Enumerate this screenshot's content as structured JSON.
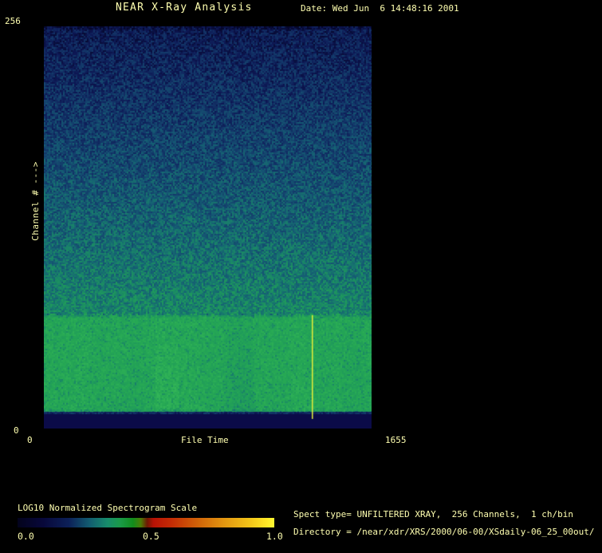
{
  "window": {
    "bg_color": "#000000",
    "text_color": "#ffffb0"
  },
  "header": {
    "title": "NEAR X-Ray Analysis",
    "date_label": "Date: Wed Jun  6 14:48:16 2001"
  },
  "plot": {
    "y_axis": {
      "label": "Channel # --->",
      "top_tick": "256",
      "bottom_tick": "0"
    },
    "x_axis": {
      "label": "File Time",
      "left_tick": "0",
      "right_tick": "1655"
    }
  },
  "colorbar": {
    "title": "LOG10 Normalized Spectrogram Scale",
    "ticks": [
      "0.0",
      "0.5",
      "1.0"
    ],
    "gradient": [
      {
        "pos": 0.0,
        "color": "#03031c"
      },
      {
        "pos": 0.1,
        "color": "#08083a"
      },
      {
        "pos": 0.2,
        "color": "#0c2058"
      },
      {
        "pos": 0.28,
        "color": "#125c70"
      },
      {
        "pos": 0.35,
        "color": "#178c6c"
      },
      {
        "pos": 0.4,
        "color": "#1a9a48"
      },
      {
        "pos": 0.45,
        "color": "#128c1c"
      },
      {
        "pos": 0.48,
        "color": "#4a7c06"
      },
      {
        "pos": 0.505,
        "color": "#6e1803"
      },
      {
        "pos": 0.53,
        "color": "#b81205"
      },
      {
        "pos": 0.6,
        "color": "#c42c05"
      },
      {
        "pos": 0.7,
        "color": "#d06208"
      },
      {
        "pos": 0.8,
        "color": "#e29410"
      },
      {
        "pos": 0.9,
        "color": "#f2c218"
      },
      {
        "pos": 0.97,
        "color": "#ffe826"
      },
      {
        "pos": 1.0,
        "color": "#fff832"
      }
    ]
  },
  "info": {
    "spect_type_line": "Spect type= UNFILTERED XRAY,  256 Channels,  1 ch/bin",
    "directory_line": "Directory = /near/xdr/XRS/2000/06-00/XSdaily-06_25_00out/"
  },
  "chart_data": {
    "type": "heatmap",
    "title": "NEAR X-Ray Analysis",
    "xlabel": "File Time",
    "ylabel": "Channel #",
    "xlim": [
      0,
      1655
    ],
    "ylim": [
      0,
      256
    ],
    "scale_label": "LOG10 Normalized Spectrogram Scale",
    "scale_range": [
      0.0,
      1.0
    ],
    "regions": [
      {
        "channels": [
          0,
          10
        ],
        "approx_norm_value": 0.05,
        "description": "flat dark navy band at bottom (no counts)",
        "color": "#0b0b48"
      },
      {
        "channels": [
          10,
          73
        ],
        "approx_norm_value": 0.78,
        "description": "bright uniform green band of high counts with faint column variations and speckle noise"
      },
      {
        "channels": [
          73,
          256
        ],
        "approx_norm_value_range": [
          0.62,
          0.15
        ],
        "description": "speckled noise fading from teal-green near channel 73 up to dark navy at channel 256"
      }
    ],
    "marker_line": {
      "file_time": 1353,
      "channels": [
        6,
        72
      ],
      "color": "#e6ee3a",
      "description": "yellow time-cursor line"
    },
    "palette_stops": [
      {
        "pos": 0.0,
        "color": "#05062a"
      },
      {
        "pos": 0.15,
        "color": "#0d1754"
      },
      {
        "pos": 0.3,
        "color": "#13386a"
      },
      {
        "pos": 0.45,
        "color": "#155c74"
      },
      {
        "pos": 0.58,
        "color": "#187e6c"
      },
      {
        "pos": 0.7,
        "color": "#1e985c"
      },
      {
        "pos": 0.82,
        "color": "#26a854"
      },
      {
        "pos": 0.92,
        "color": "#34b658"
      },
      {
        "pos": 1.0,
        "color": "#50cd5f"
      }
    ],
    "bottom_band_color": "#0b0b48"
  }
}
